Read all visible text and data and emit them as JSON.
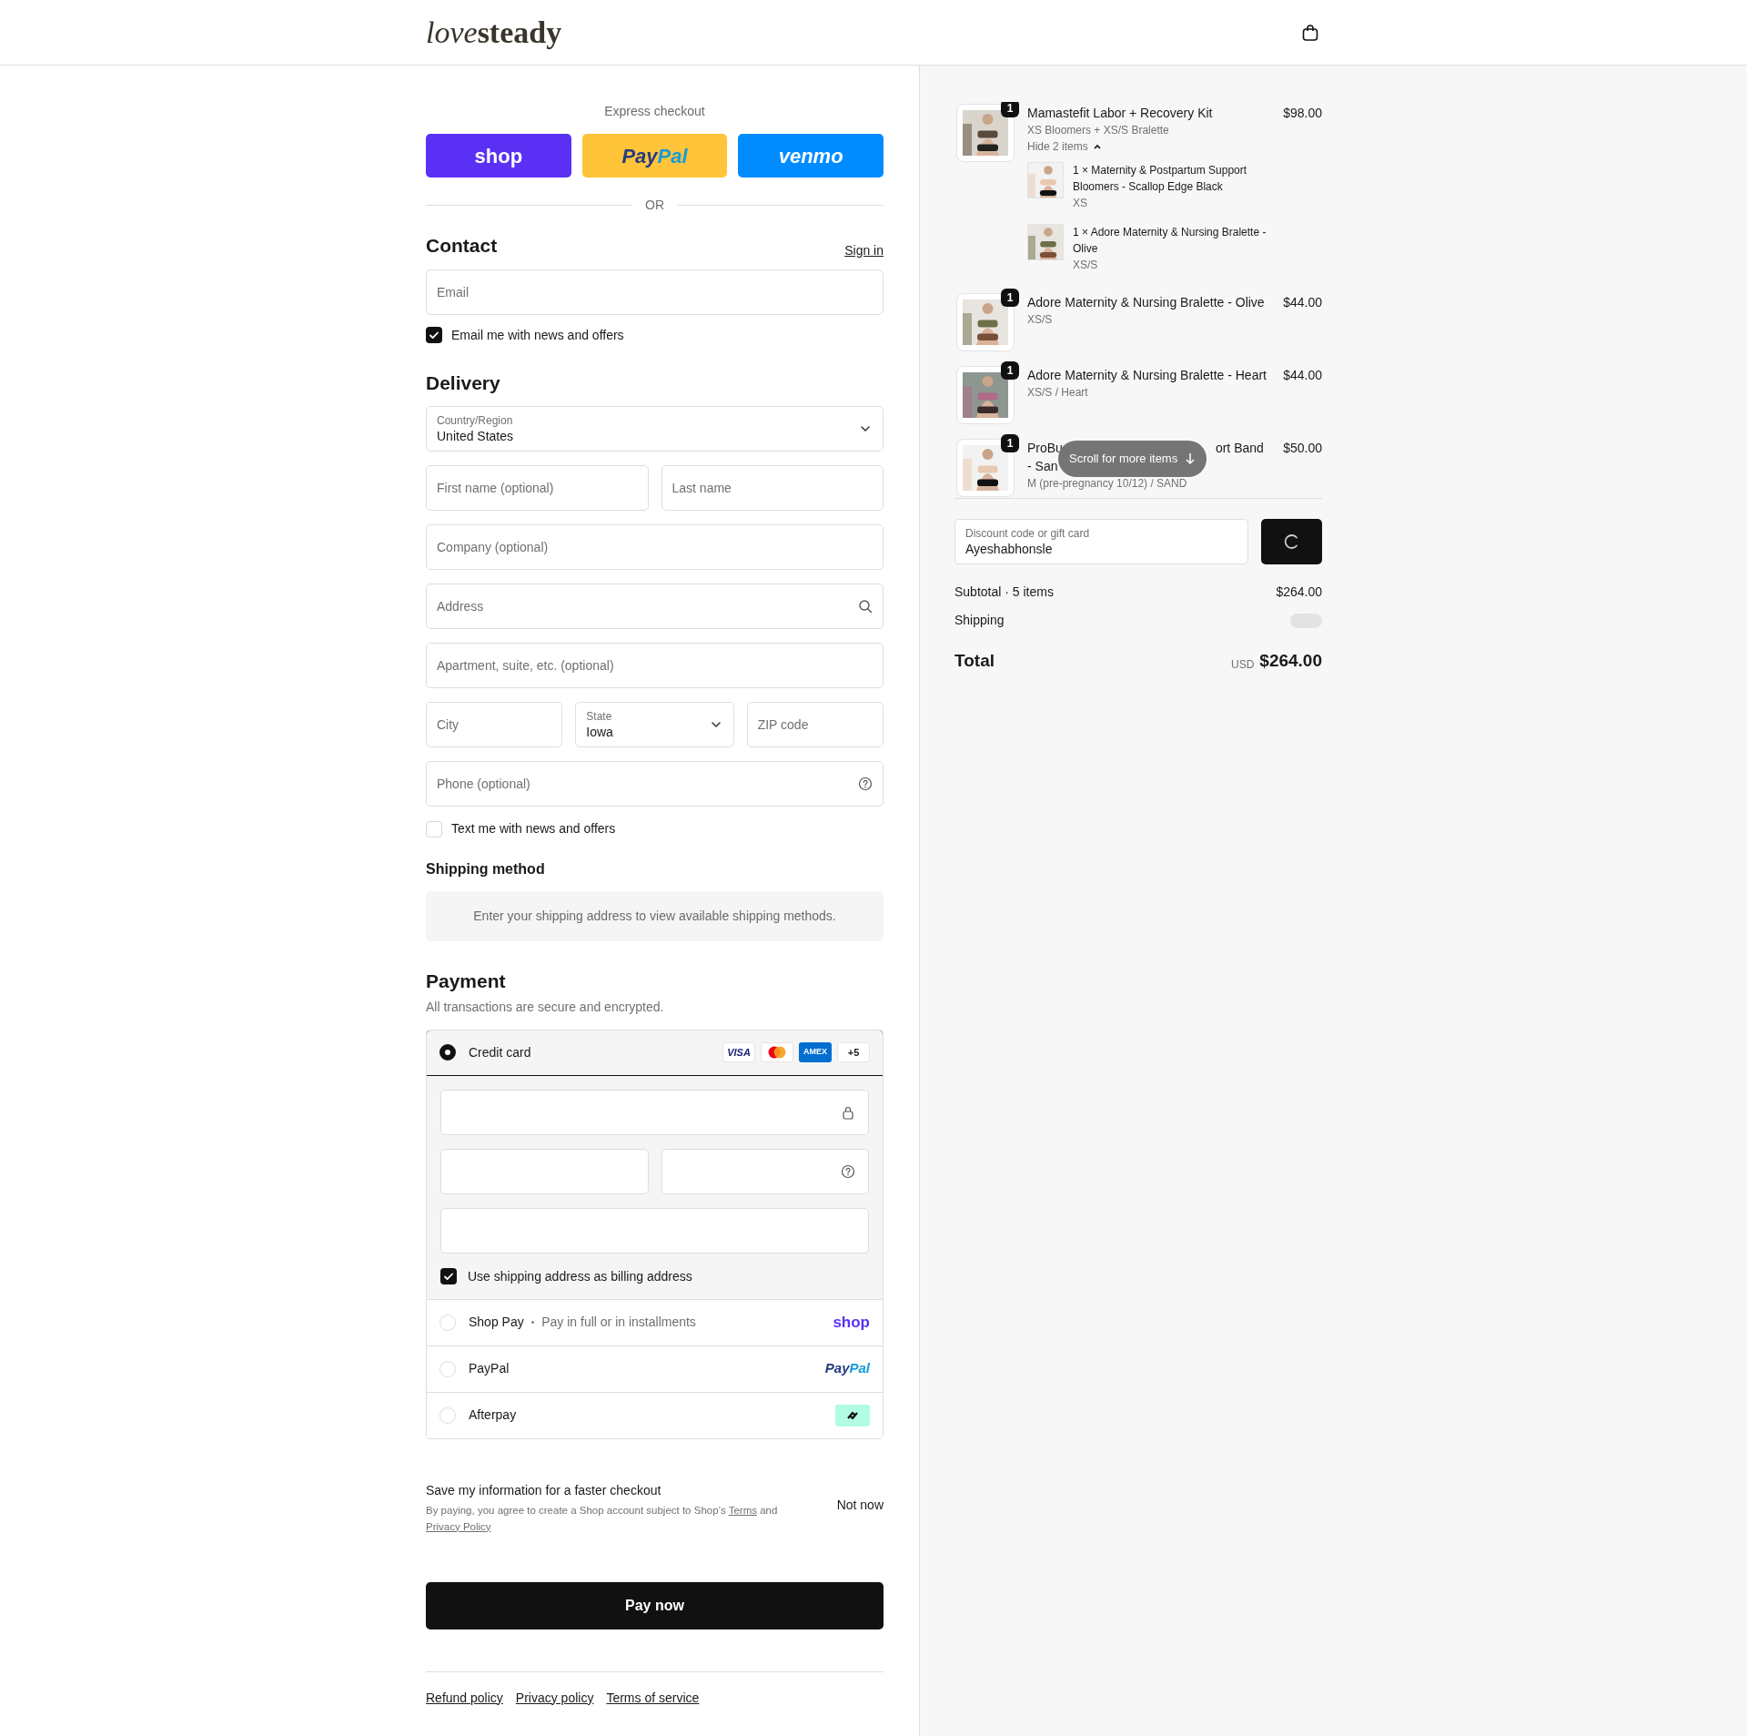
{
  "header": {
    "logo": {
      "italic": "love",
      "bold": "steady"
    }
  },
  "express": {
    "title": "Express checkout",
    "buttons": [
      {
        "kind": "shop",
        "label": "shop"
      },
      {
        "kind": "paypal",
        "label_parts": [
          "Pay",
          "Pal"
        ]
      },
      {
        "kind": "venmo",
        "label": "venmo"
      }
    ],
    "divider": "OR"
  },
  "contact": {
    "heading": "Contact",
    "sign_in": "Sign in",
    "email": {
      "placeholder": "Email"
    },
    "news": {
      "label": "Email me with news and offers",
      "checked": true
    }
  },
  "delivery": {
    "heading": "Delivery",
    "rows": [
      [
        {
          "kind": "select",
          "label": "Country/Region",
          "value": "United States"
        }
      ],
      [
        {
          "kind": "text",
          "placeholder": "First name (optional)"
        },
        {
          "kind": "text",
          "placeholder": "Last name"
        }
      ],
      [
        {
          "kind": "text",
          "placeholder": "Company (optional)"
        }
      ],
      [
        {
          "kind": "search",
          "placeholder": "Address"
        }
      ],
      [
        {
          "kind": "text",
          "placeholder": "Apartment, suite, etc. (optional)"
        }
      ],
      [
        {
          "kind": "text",
          "placeholder": "City"
        },
        {
          "kind": "select",
          "label": "State",
          "value": "Iowa"
        },
        {
          "kind": "text",
          "placeholder": "ZIP code"
        }
      ],
      [
        {
          "kind": "help",
          "placeholder": "Phone (optional)"
        }
      ]
    ],
    "sms": {
      "label": "Text me with news and offers",
      "checked": false
    }
  },
  "shipping_method": {
    "heading": "Shipping method",
    "message": "Enter your shipping address to view available shipping methods."
  },
  "payment": {
    "heading": "Payment",
    "subtitle": "All transactions are secure and encrypted.",
    "methods": [
      {
        "kind": "card",
        "label": "Credit card",
        "selected": true,
        "brands": [
          {
            "kind": "visa",
            "label": "VISA"
          },
          {
            "kind": "mastercard"
          },
          {
            "kind": "amex",
            "label": "AMEX"
          },
          {
            "kind": "more",
            "label": "+5"
          }
        ],
        "card_rows": [
          [
            {
              "kind": "lock"
            }
          ],
          [
            {
              "kind": "plain"
            },
            {
              "kind": "help"
            }
          ],
          [
            {
              "kind": "plain"
            }
          ]
        ],
        "billing": {
          "label": "Use shipping address as billing address",
          "checked": true
        }
      },
      {
        "kind": "shop_pay",
        "label": "Shop Pay",
        "separator": "•",
        "note": "Pay in full or in installments",
        "logo": "shop",
        "selected": false
      },
      {
        "kind": "paypal",
        "label": "PayPal",
        "logo_parts": [
          "Pay",
          "Pal"
        ],
        "selected": false
      },
      {
        "kind": "afterpay",
        "label": "Afterpay",
        "selected": false
      }
    ]
  },
  "save_info": {
    "title": "Save my information for a faster checkout",
    "legal": "By paying, you agree to create a Shop account subject to Shop’s",
    "terms": "Terms",
    "and": "and",
    "privacy": "Privacy Policy",
    "dismiss": "Not now"
  },
  "pay_button": "Pay now",
  "footer_links": [
    "Refund policy",
    "Privacy policy",
    "Terms of service"
  ],
  "summary": {
    "items": [
      {
        "quantity": "1",
        "name": "Mamastefit Labor + Recovery Kit",
        "variant": "XS Bloomers + XS/S Bralette",
        "price": "$98.00",
        "toggle": "Hide 2 items",
        "expanded": true,
        "components": [
          {
            "text": "1 × Maternity & Postpartum Support Bloomers - Scallop Edge Black",
            "variant": "XS"
          },
          {
            "text": "1 × Adore Maternity & Nursing Bralette - Olive",
            "variant": "XS/S"
          }
        ]
      },
      {
        "quantity": "1",
        "name": "Adore Maternity & Nursing Bralette - Olive",
        "variant": "XS/S",
        "price": "$44.00"
      },
      {
        "quantity": "1",
        "name": "Adore Maternity & Nursing Bralette - Heart",
        "variant": "XS/S / Heart",
        "price": "$44.00"
      },
      {
        "quantity": "1",
        "name_parts": [
          "ProBu",
          "ort Band",
          "- San"
        ],
        "variant": "M (pre-pregnancy 10/12) / SAND",
        "price": "$50.00"
      }
    ],
    "scroll_hint": "Scroll for more items",
    "discount": {
      "label": "Discount code or gift card",
      "value": "Ayeshabhonsle"
    },
    "subtotal_label": "Subtotal · 5 items",
    "subtotal": "$264.00",
    "shipping_label": "Shipping",
    "total_label": "Total",
    "currency": "USD",
    "total": "$264.00"
  }
}
